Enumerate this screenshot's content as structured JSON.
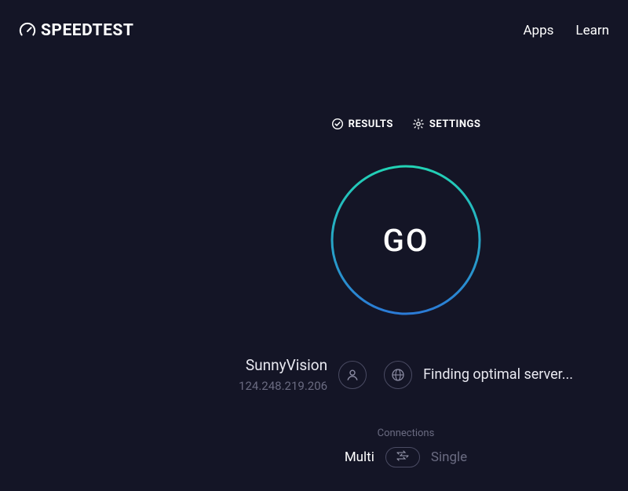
{
  "header": {
    "brand": "SPEEDTEST",
    "nav": {
      "apps": "Apps",
      "learn": "Learn"
    }
  },
  "tabs": {
    "results": "RESULTS",
    "settings": "SETTINGS"
  },
  "go": {
    "label": "GO"
  },
  "isp": {
    "name": "SunnyVision",
    "ip": "124.248.219.206"
  },
  "server": {
    "status": "Finding optimal server..."
  },
  "connections": {
    "title": "Connections",
    "multi": "Multi",
    "single": "Single"
  },
  "colors": {
    "bg": "#141526",
    "ring_top": "#22d3b5",
    "ring_bottom": "#2b7bd6",
    "muted": "#6a6b81"
  }
}
